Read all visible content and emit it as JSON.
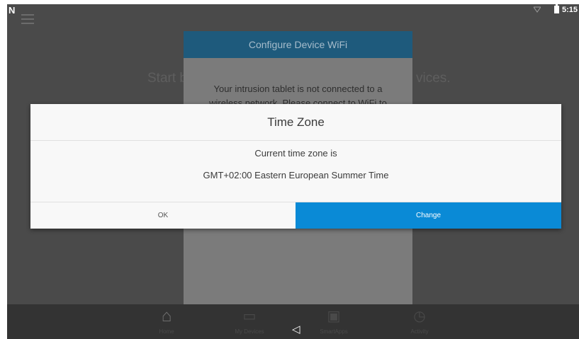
{
  "status_bar": {
    "notification_icon": "N",
    "time": "5:15"
  },
  "background_app": {
    "heading_left": "Start b",
    "heading_right": "vices.",
    "wifi_dialog": {
      "title": "Configure Device WiFi",
      "body": "Your intrusion tablet is not connected to a wireless network. Please connect to WiFi to"
    },
    "bottom_nav": {
      "items": [
        {
          "label": "Home",
          "icon": "home-icon"
        },
        {
          "label": "My Devices",
          "icon": "devices-icon"
        },
        {
          "label": "SmartApps",
          "icon": "smartapps-icon"
        },
        {
          "label": "Activity",
          "icon": "activity-icon"
        }
      ]
    }
  },
  "time_zone_dialog": {
    "title": "Time Zone",
    "line1": "Current time zone is",
    "line2": "GMT+02:00 Eastern European Summer Time",
    "ok_label": "OK",
    "change_label": "Change"
  },
  "system_nav": {
    "back_icon": "back-icon"
  },
  "colors": {
    "accent": "#0a8ad6",
    "dialog_header": "#1e5a7c"
  }
}
